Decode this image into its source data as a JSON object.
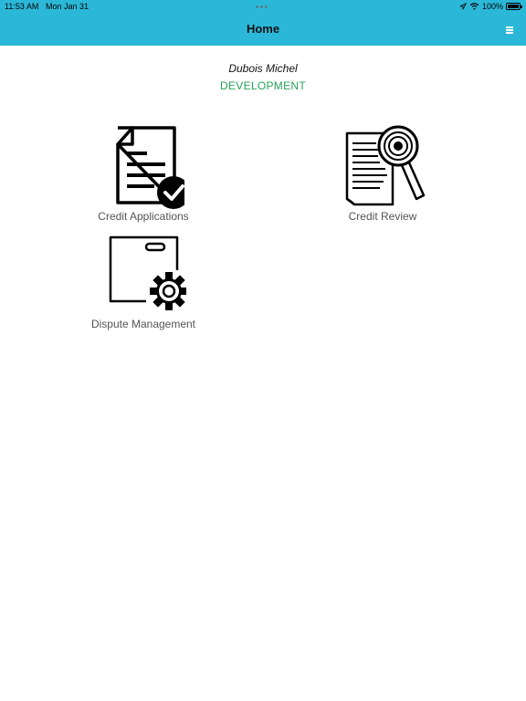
{
  "status_bar": {
    "time": "11:53 AM",
    "date": "Mon Jan 31",
    "battery": "100%",
    "battery_level": 1.0
  },
  "nav": {
    "title": "Home"
  },
  "user": {
    "name": "Dubois Michel",
    "environment": "DEVELOPMENT",
    "environment_color": "#27a35a"
  },
  "accent_color": "#2bb8d8",
  "tiles": [
    {
      "label": "Credit Applications",
      "icon": "document-check-icon"
    },
    {
      "label": "Credit Review",
      "icon": "document-magnifier-icon"
    },
    {
      "label": "Dispute Management",
      "icon": "box-gear-icon"
    }
  ]
}
